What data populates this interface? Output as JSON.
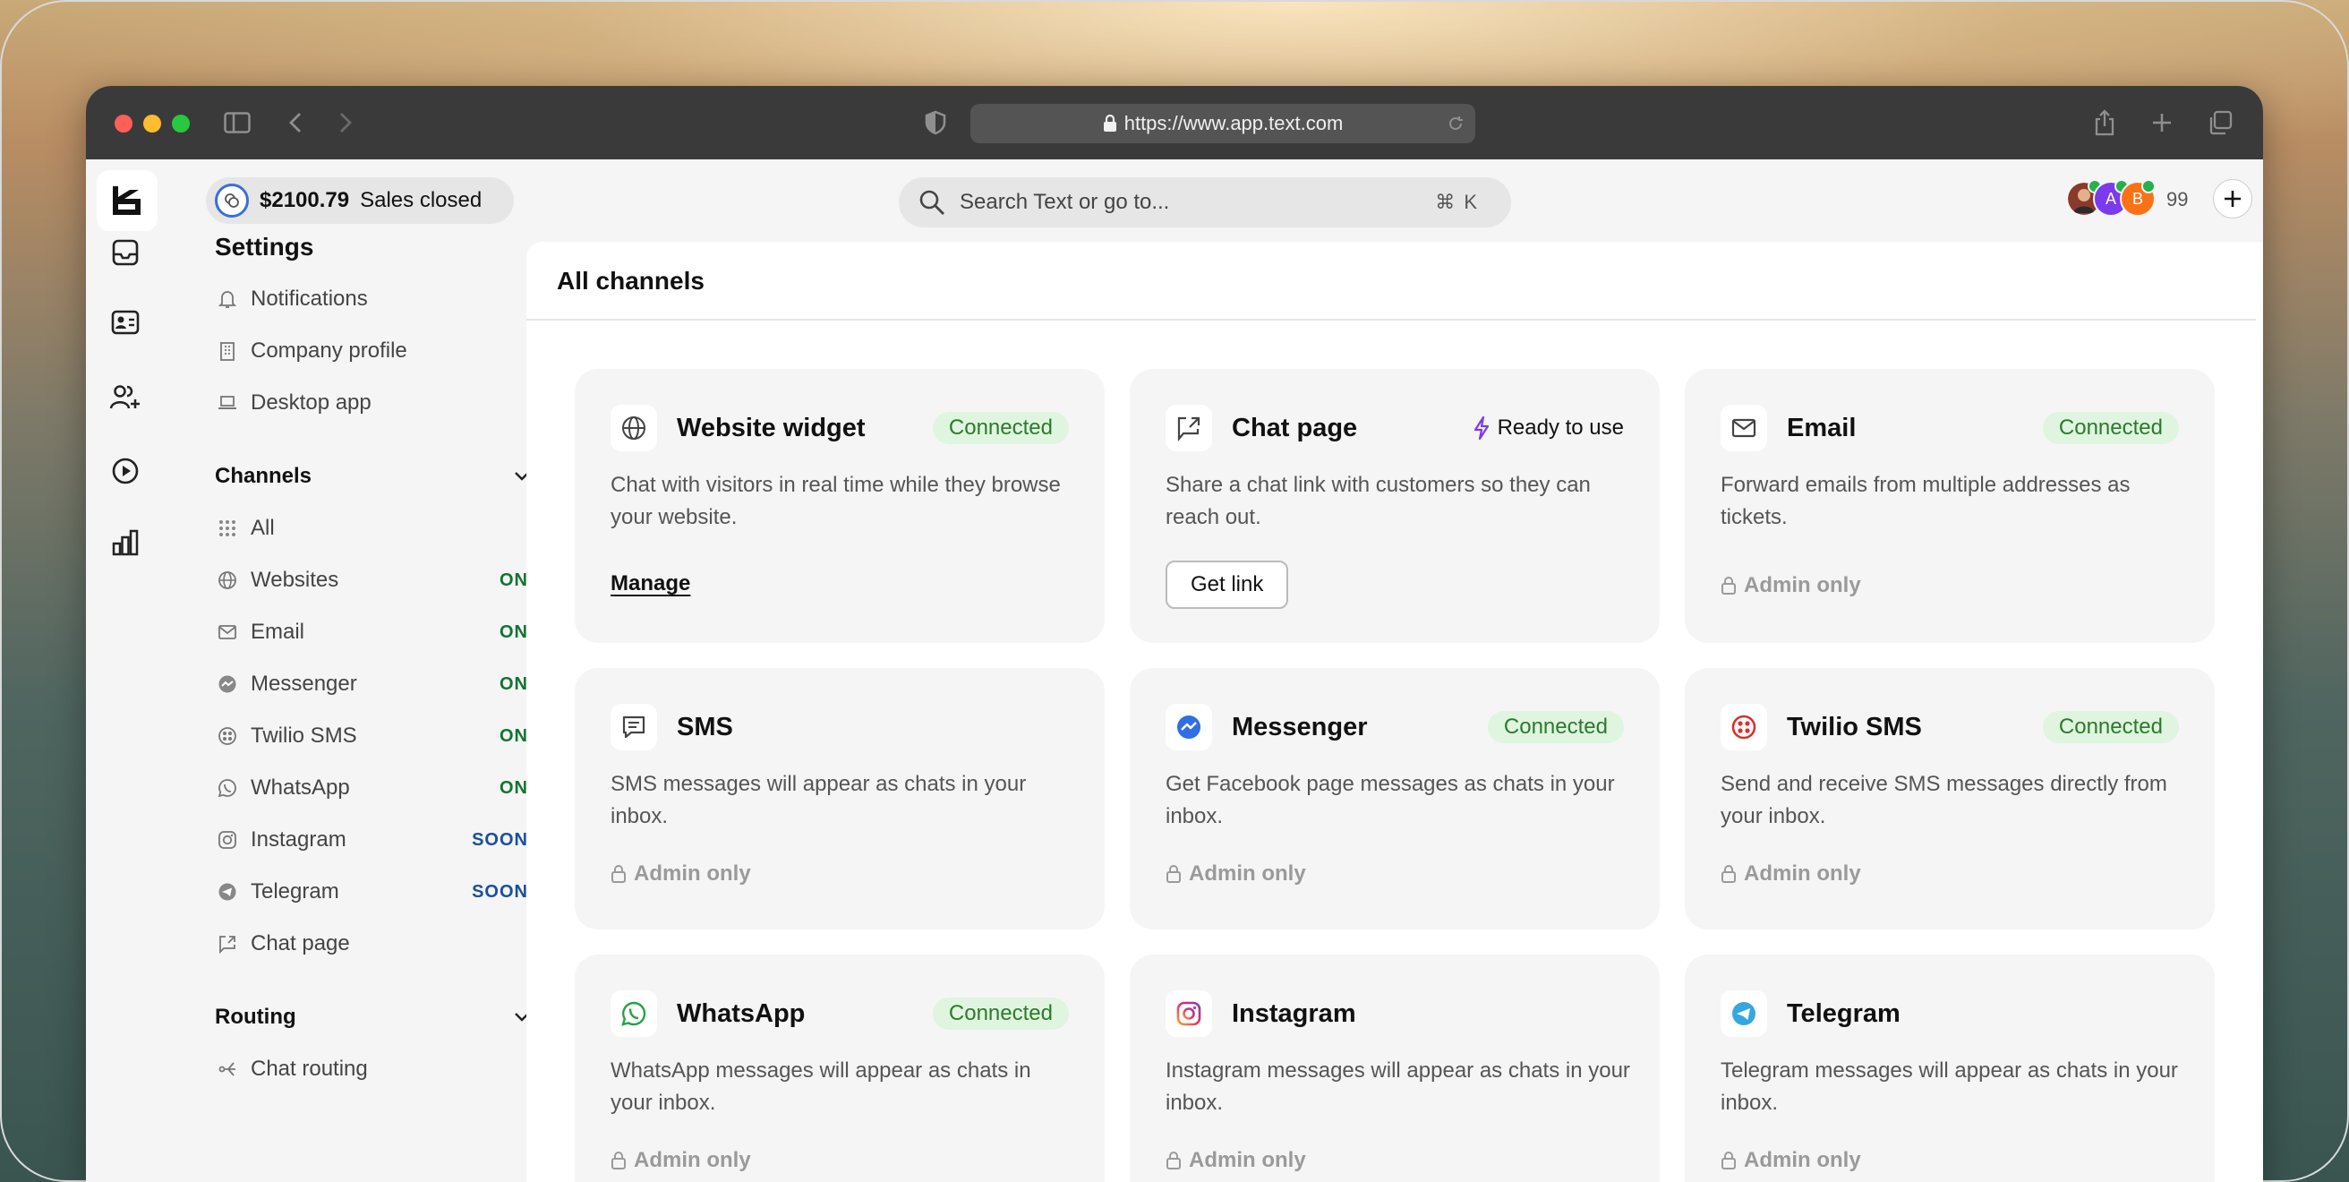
{
  "browser": {
    "url": "https://www.app.text.com"
  },
  "topbar": {
    "sales_amount": "$2100.79",
    "sales_label": "Sales closed",
    "search_placeholder": "Search Text or go to...",
    "search_shortcut": "⌘ K",
    "avatars": [
      {
        "initial": "",
        "color": "#8a3a2a"
      },
      {
        "initial": "A",
        "color": "#7c3aed"
      },
      {
        "initial": "B",
        "color": "#f97316"
      }
    ],
    "avatar_count": "99"
  },
  "settings": {
    "title": "Settings",
    "general_items": [
      {
        "label": "Notifications",
        "icon": "bell-icon"
      },
      {
        "label": "Company profile",
        "icon": "building-icon"
      },
      {
        "label": "Desktop app",
        "icon": "laptop-icon"
      }
    ],
    "channels_heading": "Channels",
    "channel_items": [
      {
        "label": "All",
        "badge": ""
      },
      {
        "label": "Websites",
        "badge": "ON"
      },
      {
        "label": "Email",
        "badge": "ON"
      },
      {
        "label": "Messenger",
        "badge": "ON"
      },
      {
        "label": "Twilio SMS",
        "badge": "ON"
      },
      {
        "label": "WhatsApp",
        "badge": "ON"
      },
      {
        "label": "Instagram",
        "badge": "SOON"
      },
      {
        "label": "Telegram",
        "badge": "SOON"
      },
      {
        "label": "Chat page",
        "badge": ""
      }
    ],
    "routing_heading": "Routing",
    "routing_items": [
      {
        "label": "Chat routing"
      }
    ]
  },
  "main": {
    "title": "All channels",
    "cards": [
      {
        "name": "Website widget",
        "status": "Connected",
        "desc": "Chat with visitors in real time while they browse your website.",
        "action": "Manage"
      },
      {
        "name": "Chat page",
        "status": "Ready to use",
        "desc": "Share a chat link with customers so they can reach out.",
        "action": "Get link"
      },
      {
        "name": "Email",
        "status": "Connected",
        "desc": "Forward emails from multiple addresses as tickets.",
        "action": "Admin only"
      },
      {
        "name": "SMS",
        "status": "",
        "desc": "SMS messages will appear as chats in your inbox.",
        "action": "Admin only"
      },
      {
        "name": "Messenger",
        "status": "Connected",
        "desc": "Get Facebook page messages as chats in your inbox.",
        "action": "Admin only"
      },
      {
        "name": "Twilio SMS",
        "status": "Connected",
        "desc": "Send and receive SMS messages directly from your inbox.",
        "action": "Admin only"
      },
      {
        "name": "WhatsApp",
        "status": "Connected",
        "desc": "WhatsApp messages will appear as chats in your inbox.",
        "action": "Admin only"
      },
      {
        "name": "Instagram",
        "status": "",
        "desc": "Instagram messages will appear as chats in your inbox.",
        "action": "Admin only"
      },
      {
        "name": "Telegram",
        "status": "",
        "desc": "Telegram messages will appear as chats in your inbox.",
        "action": "Admin only"
      }
    ]
  },
  "colors": {
    "on": "#137333",
    "soon": "#1a4fa0",
    "connected_bg": "#dff5df",
    "connected_text": "#2d7a2d",
    "ready_icon": "#7c3aed"
  }
}
